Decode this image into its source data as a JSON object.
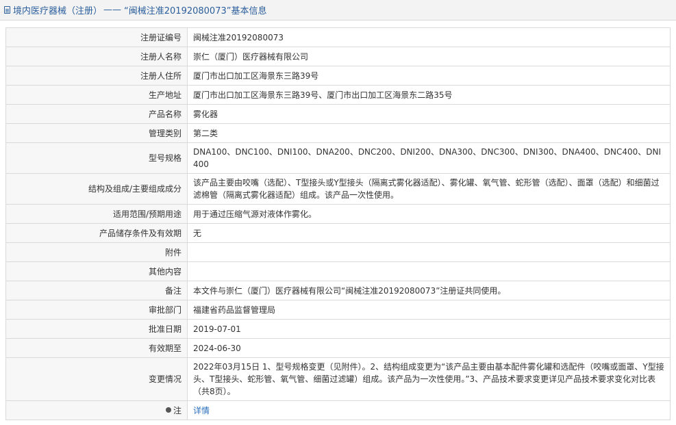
{
  "title": {
    "category": "境内医疗器械（注册）",
    "separator": " ——",
    "main": "“闽械注准20192080073”基本信息"
  },
  "rows": [
    {
      "label": "注册证编号",
      "value": "闽械注准20192080073"
    },
    {
      "label": "注册人名称",
      "value": "崇仁（厦门）医疗器械有限公司"
    },
    {
      "label": "注册人住所",
      "value": "厦门市出口加工区海景东三路39号"
    },
    {
      "label": "生产地址",
      "value": "厦门市出口加工区海景东三路39号、厦门市出口加工区海景东二路35号"
    },
    {
      "label": "产品名称",
      "value": "雾化器"
    },
    {
      "label": "管理类别",
      "value": "第二类"
    },
    {
      "label": "型号规格",
      "value": "DNA100、DNC100、DNI100、DNA200、DNC200、DNI200、DNA300、DNC300、DNI300、DNA400、DNC400、DNI400"
    },
    {
      "label": "结构及组成/主要组成成分",
      "value": "该产品主要由咬嘴（选配）、T型接头或Y型接头（隔离式雾化器适配）、雾化罐、氧气管、蛇形管（选配）、面罩（选配）和细菌过滤棉管（隔离式雾化器适配）组成。该产品一次性使用。"
    },
    {
      "label": "适用范围/预期用途",
      "value": "用于通过压缩气源对液体作雾化。"
    },
    {
      "label": "产品储存条件及有效期",
      "value": "无"
    },
    {
      "label": "附件",
      "value": ""
    },
    {
      "label": "其他内容",
      "value": ""
    },
    {
      "label": "备注",
      "value": "本文件与崇仁（厦门）医疗器械有限公司“闽械注准20192080073”注册证共同使用。"
    },
    {
      "label": "审批部门",
      "value": "福建省药品监督管理局"
    },
    {
      "label": "批准日期",
      "value": "2019-07-01"
    },
    {
      "label": "有效期至",
      "value": "2024-06-30"
    },
    {
      "label": "变更情况",
      "value": "2022年03月15日 1、型号规格变更（见附件）。2、结构组成变更为“该产品主要由基本配件雾化罐和选配件（咬嘴或面罩、Y型接头、T型接头、蛇形管、氧气管、细菌过滤罐）组成。该产品为一次性使用。”3、产品技术要求变更详见产品技术要求变化对比表（共8页）。"
    }
  ],
  "note": {
    "label": "注",
    "link_text": "详情"
  }
}
